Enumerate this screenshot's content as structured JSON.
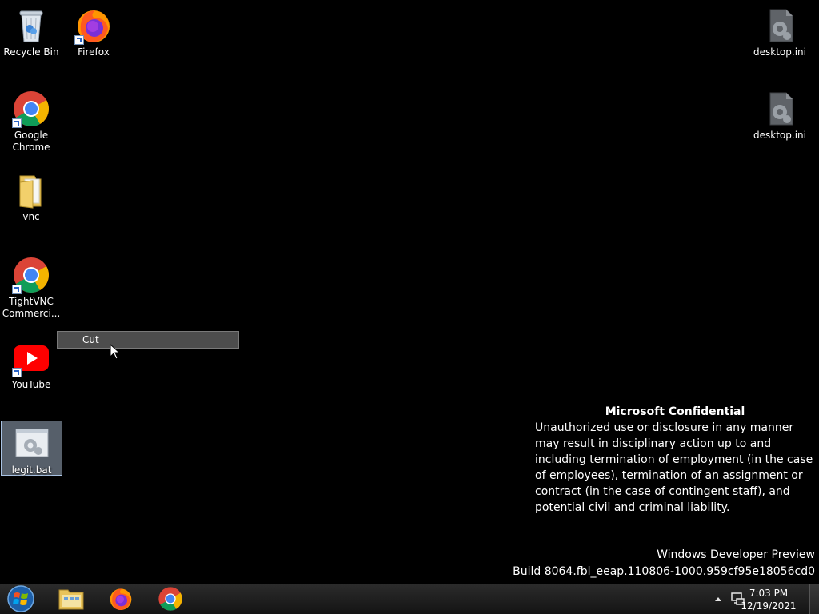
{
  "desktop": {
    "icons": {
      "recycle_bin": "Recycle Bin",
      "firefox": "Firefox",
      "chrome": "Google Chrome",
      "vnc": "vnc",
      "tightvnc": "TightVNC Commerci...",
      "youtube": "YouTube",
      "legit_bat": "legit.bat",
      "desktop_ini_1": "desktop.ini",
      "desktop_ini_2": "desktop.ini"
    },
    "selected_icon": "legit.bat"
  },
  "context_menu": {
    "highlighted_item": "Cut"
  },
  "watermark": {
    "title": "Microsoft Confidential",
    "body": "Unauthorized use or disclosure in any manner may result in disciplinary action up to and including termination of employment (in the case of employees), termination of an assignment or contract (in the case of contingent staff), and potential civil and criminal liability.",
    "product": "Windows Developer Preview",
    "build": "Build 8064.fbl_eeap.110806-1000.959cf95e18056cd0"
  },
  "taskbar": {
    "start_icon": "windows-orb-icon",
    "pinned": [
      "file-explorer-icon",
      "firefox-icon",
      "chrome-icon"
    ],
    "clock_time": "7:03 PM",
    "clock_date": "12/19/2021",
    "tray_icons": [
      "show-hidden-icons",
      "network-icon"
    ]
  },
  "colors": {
    "desktop_bg": "#000000",
    "selection": "#bed2eb",
    "menu_highlight": "#4d4d4d"
  }
}
